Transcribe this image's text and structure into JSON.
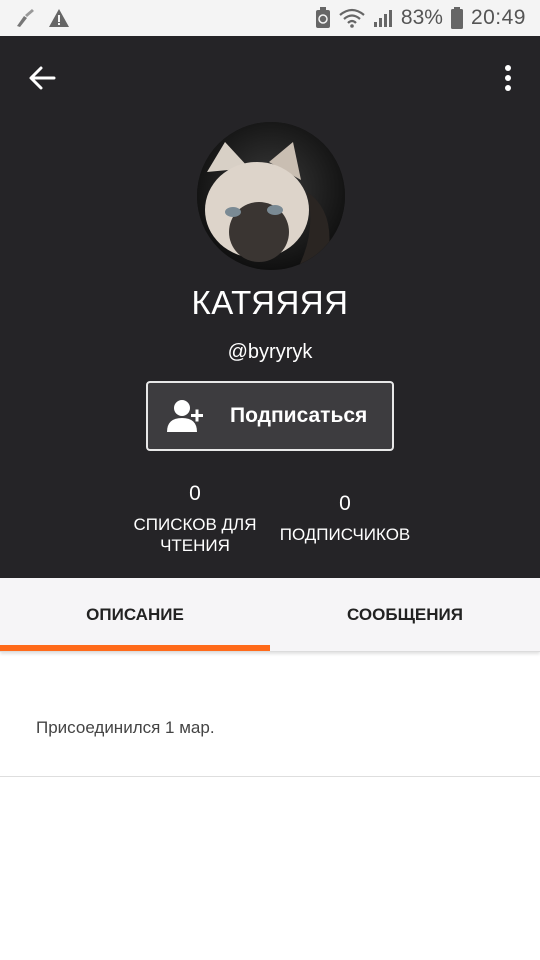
{
  "status_bar": {
    "battery_percent": "83%",
    "time": "20:49",
    "icons": [
      "broom-icon",
      "warning-icon",
      "recycle-icon",
      "wifi-icon",
      "signal-icon",
      "battery-icon"
    ]
  },
  "profile": {
    "display_name": "КАТЯЯЯЯ",
    "username": "@byryryk",
    "follow_label": "Подписаться",
    "stats": {
      "reading_lists_count": "0",
      "reading_lists_label_line1": "СПИСКОВ ДЛЯ",
      "reading_lists_label_line2": "ЧТЕНИЯ",
      "followers_count": "0",
      "followers_label": "ПОДПИСЧИКОВ"
    }
  },
  "tabs": [
    {
      "label": "ОПИСАНИЕ",
      "active": true
    },
    {
      "label": "СООБЩЕНИЯ",
      "active": false
    }
  ],
  "about": {
    "joined_text": "Присоединился 1 мар."
  },
  "colors": {
    "header_bg": "#252427",
    "accent": "#ff6a1a",
    "button_bg": "#3d3c3f"
  }
}
